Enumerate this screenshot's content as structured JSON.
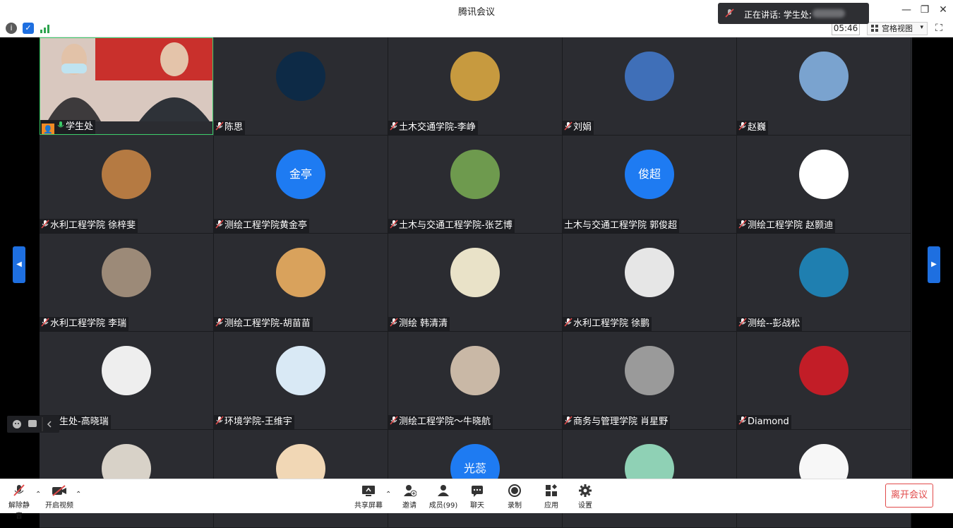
{
  "window": {
    "title": "腾讯会议",
    "min": "—",
    "restore": "❐",
    "close": "✕"
  },
  "toolbar": {
    "timer": "05:46",
    "view_label": "宫格视图",
    "view_caret": "▾",
    "fullscreen": "⛶"
  },
  "speaking": {
    "text": "正在讲话: 学生处;"
  },
  "nav": {
    "prev": "◀",
    "next": "▶"
  },
  "tiles": [
    {
      "name": "学生处",
      "kind": "video"
    },
    {
      "name": "陈思",
      "kind": "img",
      "color": "#0d2a46"
    },
    {
      "name": "土木交通学院-李峥",
      "kind": "img",
      "color": "#c79a3f"
    },
    {
      "name": "刘娟",
      "kind": "img",
      "color": "#3f6fb8"
    },
    {
      "name": "赵巍",
      "kind": "img",
      "color": "#7aa3cf"
    },
    {
      "name": "水利工程学院 徐梓斐",
      "kind": "img",
      "color": "#b57a42"
    },
    {
      "name": "测绘工程学院黄金亭",
      "kind": "text",
      "initials": "金亭"
    },
    {
      "name": "土木与交通工程学院-张艺博",
      "kind": "img",
      "color": "#6e9a4e"
    },
    {
      "name": "土木与交通工程学院 郭俊超",
      "kind": "text",
      "initials": "俊超",
      "nomic": true
    },
    {
      "name": "测绘工程学院 赵颢迪",
      "kind": "img",
      "color": "#ffffff"
    },
    {
      "name": "水利工程学院 李瑞",
      "kind": "img",
      "color": "#9c8a78"
    },
    {
      "name": "测绘工程学院-胡苗苗",
      "kind": "img",
      "color": "#d9a25c"
    },
    {
      "name": "测绘 韩清清",
      "kind": "img",
      "color": "#e9e2c8"
    },
    {
      "name": "水利工程学院 徐鹏",
      "kind": "img",
      "color": "#e6e6e6"
    },
    {
      "name": "测绘--彭战松",
      "kind": "img",
      "color": "#1f7fb0"
    },
    {
      "name": "学生处-高晓瑞",
      "kind": "img",
      "color": "#eeeeee"
    },
    {
      "name": "环境学院-王维宇",
      "kind": "img",
      "color": "#d9e9f5"
    },
    {
      "name": "测绘工程学院～牛晓航",
      "kind": "img",
      "color": "#c9b8a6"
    },
    {
      "name": "商务与管理学院 肖星野",
      "kind": "img",
      "color": "#9a9a9a"
    },
    {
      "name": "Diamond",
      "kind": "img",
      "color": "#c21d27"
    },
    {
      "name": "",
      "kind": "img",
      "color": "#d8d2c8"
    },
    {
      "name": "",
      "kind": "img",
      "color": "#f1d7b5"
    },
    {
      "name": "",
      "kind": "text",
      "initials": "光蕊"
    },
    {
      "name": "",
      "kind": "img",
      "color": "#8fd1b5"
    },
    {
      "name": "",
      "kind": "img",
      "color": "#f7f7f7"
    }
  ],
  "bottom": {
    "unmute": "解除静音",
    "start_video": "开启视频",
    "share": "共享屏幕",
    "invite": "邀请",
    "members": "成员(99)",
    "chat": "聊天",
    "record": "录制",
    "apps": "应用",
    "settings": "设置",
    "leave": "离开会议"
  },
  "colors": {
    "accent": "#1e7bf2",
    "leave": "#e14a4a",
    "tile_bg": "#2b2c31"
  }
}
